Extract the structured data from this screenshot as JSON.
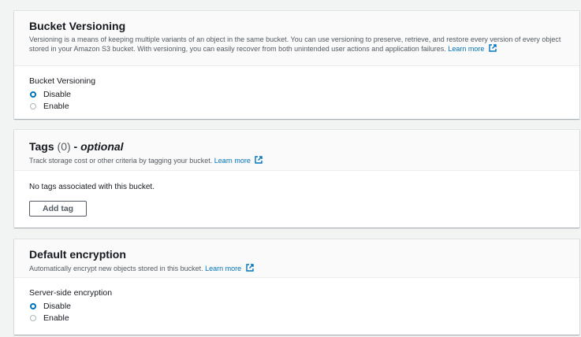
{
  "versioning": {
    "title": "Bucket Versioning",
    "description": "Versioning is a means of keeping multiple variants of an object in the same bucket. You can use versioning to preserve, retrieve, and restore every version of every object stored in your Amazon S3 bucket. With versioning, you can easily recover from both unintended user actions and application failures.",
    "learn_more": "Learn more",
    "field_label": "Bucket Versioning",
    "options": [
      "Disable",
      "Enable"
    ],
    "selected": "Disable"
  },
  "tags": {
    "title": "Tags",
    "count": "(0)",
    "separator": " - ",
    "optional": "optional",
    "description": "Track storage cost or other criteria by tagging your bucket.",
    "learn_more": "Learn more",
    "empty_text": "No tags associated with this bucket.",
    "add_button": "Add tag"
  },
  "encryption": {
    "title": "Default encryption",
    "description": "Automatically encrypt new objects stored in this bucket.",
    "learn_more": "Learn more",
    "field_label": "Server-side encryption",
    "options": [
      "Disable",
      "Enable"
    ],
    "selected": "Disable"
  },
  "colors": {
    "link": "#0073bb",
    "page_bg": "#f2f3f3",
    "radio_selected": "#0073bb"
  },
  "icons": [
    "external-link-icon"
  ]
}
